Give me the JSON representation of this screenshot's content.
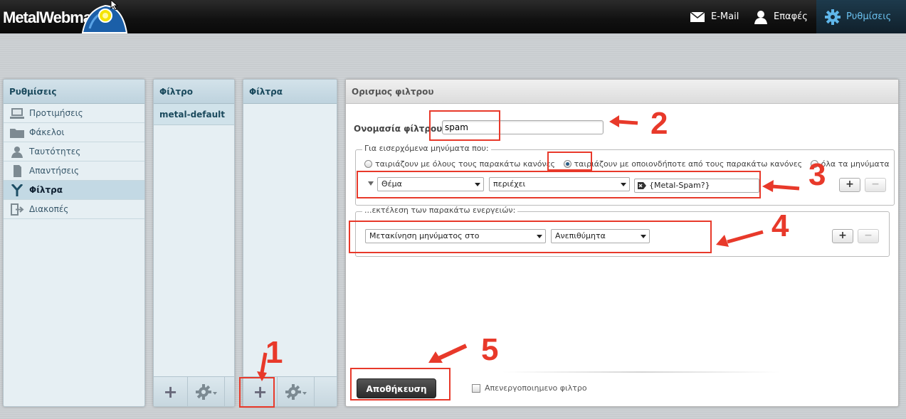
{
  "app": {
    "logo_text": "MetalWebmail"
  },
  "topnav": {
    "email": "E-Mail",
    "contacts": "Επαφές",
    "settings": "Ρυθμίσεις"
  },
  "settings_panel": {
    "title": "Ρυθμίσεις",
    "items": [
      {
        "label": "Προτιμήσεις",
        "icon": "monitor-icon"
      },
      {
        "label": "Φάκελοι",
        "icon": "folder-icon"
      },
      {
        "label": "Ταυτότητες",
        "icon": "person-icon"
      },
      {
        "label": "Απαντήσεις",
        "icon": "document-icon"
      },
      {
        "label": "Φίλτρα",
        "icon": "filter-icon",
        "selected": true
      },
      {
        "label": "Διακοπές",
        "icon": "exit-icon"
      }
    ]
  },
  "filter_set_panel": {
    "title": "Φίλτρο",
    "items": [
      "metal-default"
    ]
  },
  "filters_panel": {
    "title": "Φίλτρα"
  },
  "definition": {
    "title": "Ορισμος φιλτρου",
    "name_label": "Ονομασία φίλτρου:",
    "name_value": "spam",
    "match_legend": "Για εισερχόμενα μηνύματα που:",
    "match_options": [
      {
        "label": "ταιριάζουν με όλους τους παρακάτω κανόνες",
        "checked": false
      },
      {
        "label": "ταιριάζουν με οποιονδήποτε από τους παρακάτω κανόνες",
        "checked": true
      },
      {
        "label": "όλα τα μηνύματα",
        "checked": false
      }
    ],
    "rule": {
      "header": "Θέμα",
      "operator": "περιέχει",
      "value": "{Metal-Spam?}"
    },
    "actions_legend": "...εκτέλεση των παρακάτω ενεργειών:",
    "action": {
      "type": "Μετακίνηση μηνύματος στο",
      "target": "Ανεπιθύμητα"
    },
    "save_label": "Αποθήκευση",
    "disabled_label": "Απενεργοποιημενο φιλτρο"
  },
  "annotations": [
    "1",
    "2",
    "3",
    "4",
    "5"
  ],
  "colors": {
    "annotation": "#e8392a",
    "accent": "#6bc1ef"
  }
}
